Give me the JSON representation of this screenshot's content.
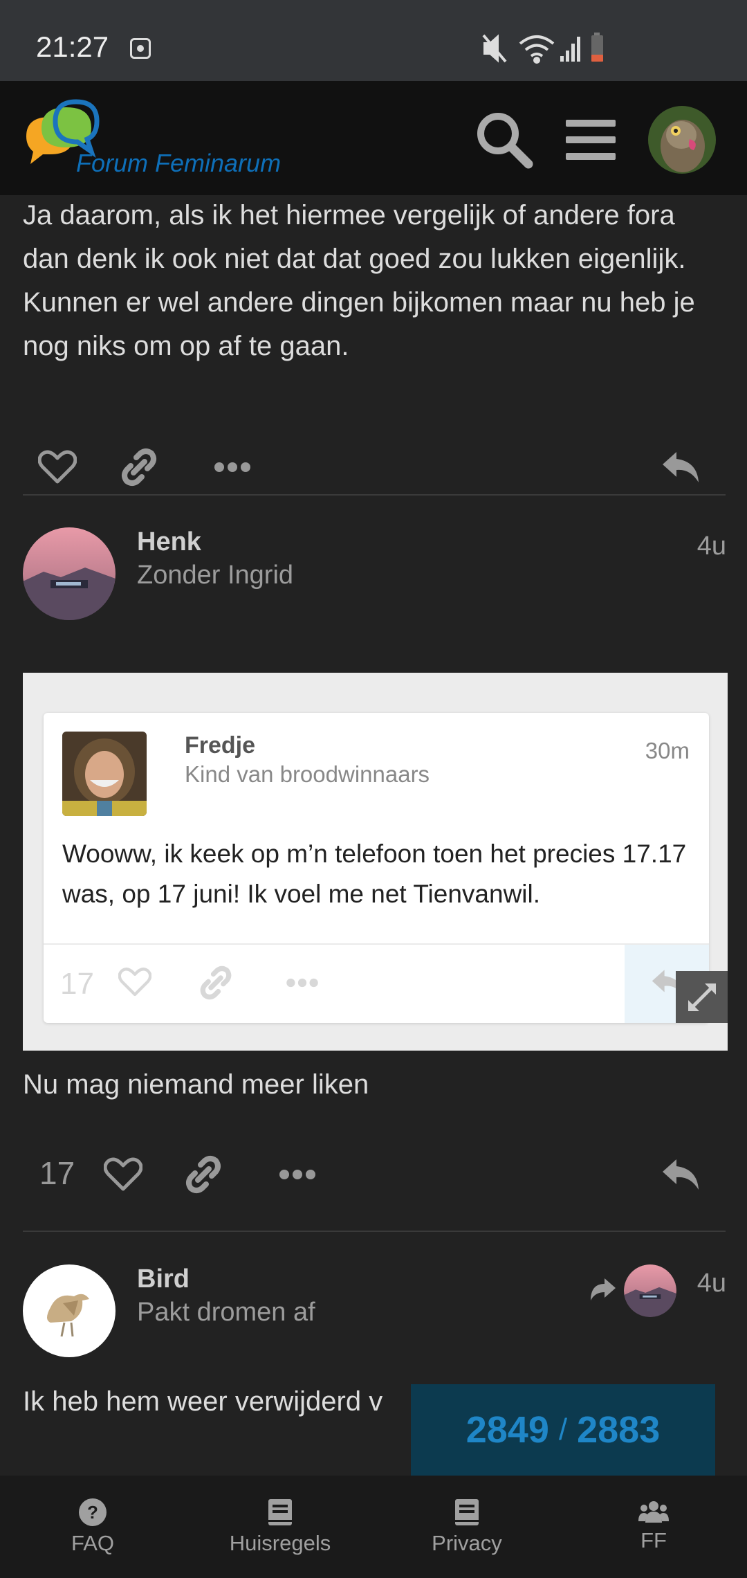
{
  "status_bar": {
    "time": "21:27"
  },
  "header": {
    "site_name": "Forum Feminarum"
  },
  "posts": [
    {
      "text": "Ja daarom, als ik het hiermee vergelijk of andere fora dan denk ik ook niet dat dat goed zou lukken eigenlijk. Kunnen er wel andere dingen bijkomen maar nu heb je nog niks om op af te gaan."
    },
    {
      "username": "Henk",
      "user_title": "Zonder Ingrid",
      "time": "4u",
      "embed": {
        "username": "Fredje",
        "user_title": "Kind van broodwinnaars",
        "time": "30m",
        "text": "Wooww, ik keek op m’n telefoon toen het precies 17.17 was, op 17 juni! Ik voel me net Tienvanwil.",
        "like_count": "17"
      },
      "text": "Nu mag niemand meer liken",
      "like_count": "17"
    },
    {
      "username": "Bird",
      "user_title": "Pakt dromen af",
      "time": "4u",
      "text": "Ik heb hem weer verwijderd v"
    }
  ],
  "progress": {
    "current": "2849",
    "separator": "/",
    "total": "2883"
  },
  "bottom_nav": [
    {
      "label": "FAQ",
      "icon": "question-icon"
    },
    {
      "label": "Huisregels",
      "icon": "book-icon"
    },
    {
      "label": "Privacy",
      "icon": "book-icon"
    },
    {
      "label": "FF",
      "icon": "users-icon"
    }
  ],
  "colors": {
    "background": "#222222",
    "header": "#111111",
    "accent": "#1f86c7",
    "progress_bg": "#0c3a4f"
  }
}
